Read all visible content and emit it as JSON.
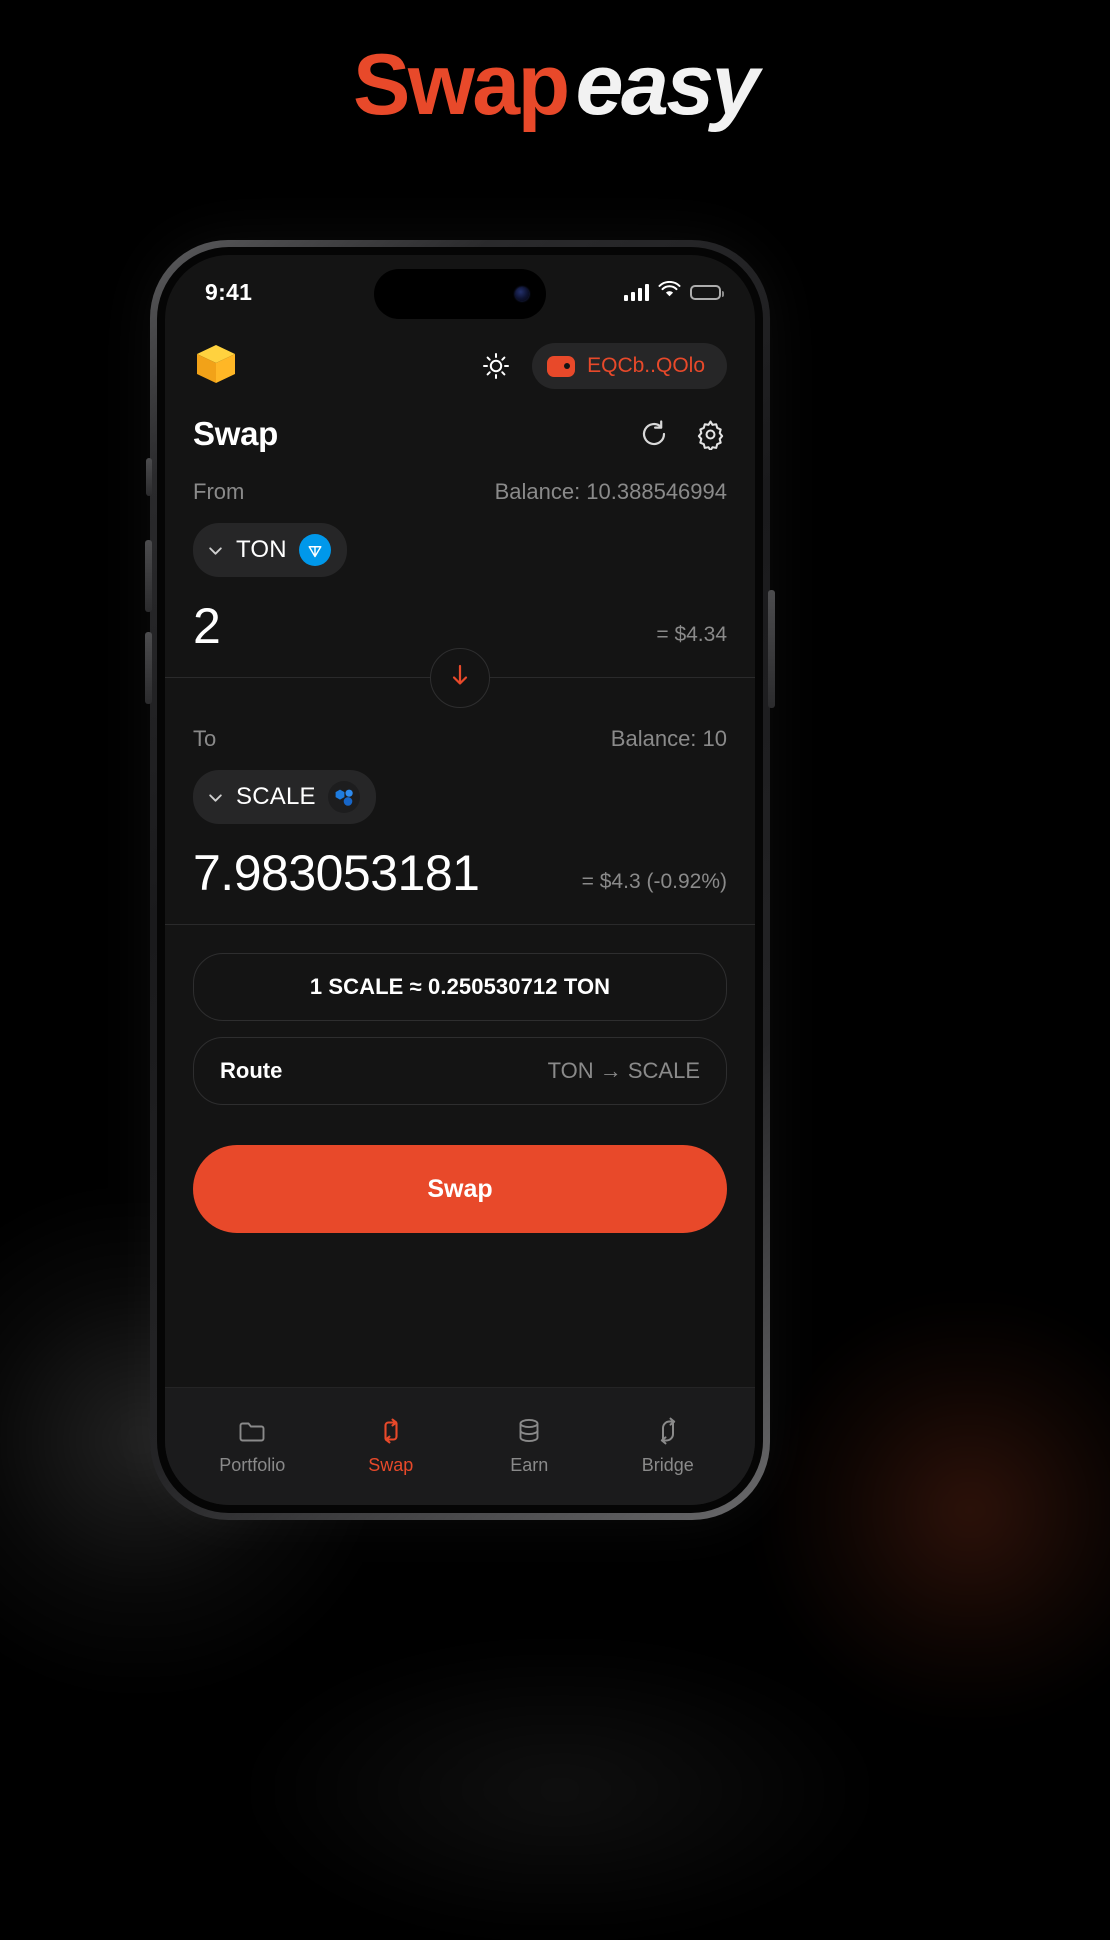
{
  "headline": {
    "part1": "Swap",
    "part2": "easy"
  },
  "colors": {
    "accent": "#E8492A",
    "ton_blue": "#0098EA",
    "muted": "#8a8a8a",
    "screen_bg": "#141414"
  },
  "statusbar": {
    "time": "9:41",
    "signal_icon": "cellular-signal-icon",
    "wifi_icon": "wifi-icon",
    "battery_icon": "battery-icon"
  },
  "header": {
    "logo_icon": "cube-logo-icon",
    "theme_toggle_icon": "sun-icon",
    "wallet": {
      "icon": "wallet-icon",
      "address": "EQCb..QOlo"
    }
  },
  "swap": {
    "title": "Swap",
    "refresh_icon": "refresh-icon",
    "settings_icon": "gear-icon",
    "from": {
      "label": "From",
      "balance": "Balance: 10.388546994",
      "token": "TON",
      "token_badge_icon": "ton-diamond-icon",
      "chevron_icon": "chevron-down-icon",
      "amount": "2",
      "usd": "= $4.34"
    },
    "direction_icon": "arrow-down-icon",
    "to": {
      "label": "To",
      "balance": "Balance: 10",
      "token": "SCALE",
      "token_badge_icon": "scale-hex-icon",
      "chevron_icon": "chevron-down-icon",
      "amount": "7.983053181",
      "usd": "= $4.3  (-0.92%)"
    },
    "rate": "1 SCALE ≈ 0.250530712 TON",
    "route": {
      "label": "Route",
      "value": "TON → SCALE"
    },
    "cta": "Swap"
  },
  "bottom_nav": {
    "items": [
      {
        "label": "Portfolio",
        "icon": "folder-icon",
        "active": false
      },
      {
        "label": "Swap",
        "icon": "swap-arrows-icon",
        "active": true
      },
      {
        "label": "Earn",
        "icon": "database-icon",
        "active": false
      },
      {
        "label": "Bridge",
        "icon": "bridge-arrows-icon",
        "active": false
      }
    ]
  }
}
